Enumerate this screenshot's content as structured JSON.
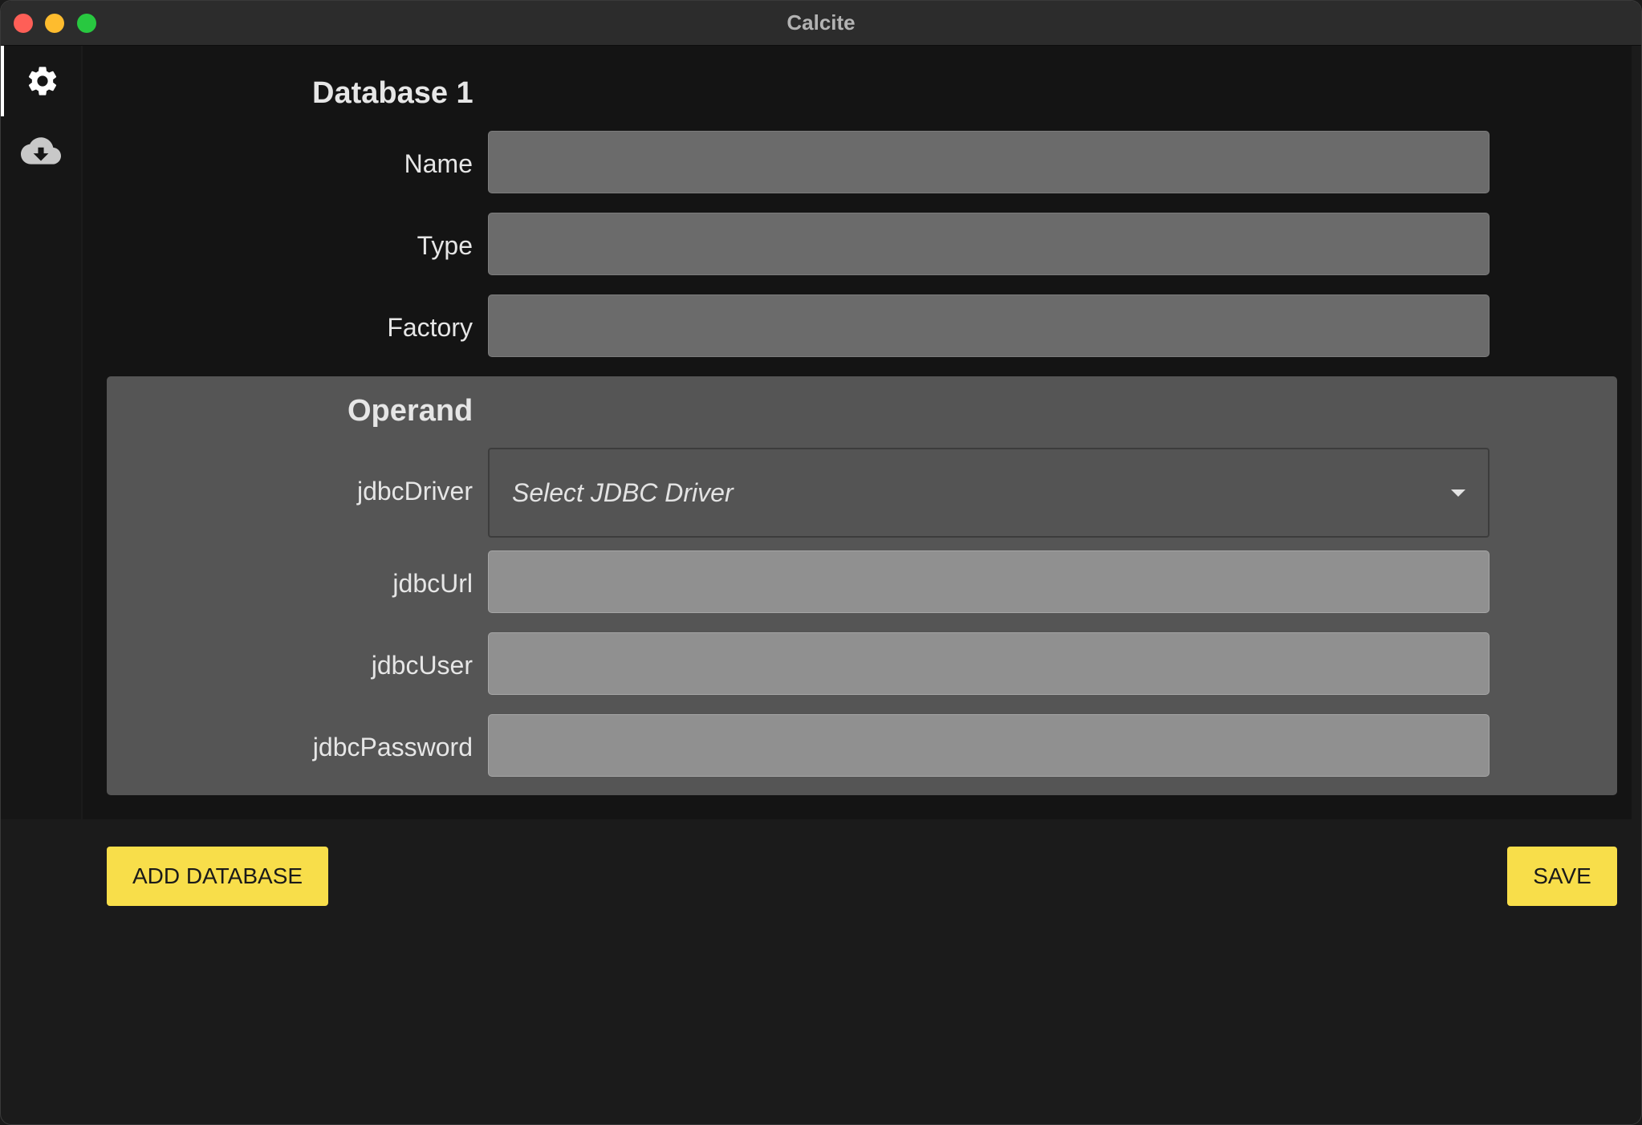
{
  "window": {
    "title": "Calcite"
  },
  "sidebar": {
    "items": [
      {
        "icon": "gear-icon",
        "active": true
      },
      {
        "icon": "cloud-download-icon",
        "active": false
      }
    ]
  },
  "database": {
    "title": "Database 1",
    "fields": [
      {
        "label": "Name",
        "value": ""
      },
      {
        "label": "Type",
        "value": ""
      },
      {
        "label": "Factory",
        "value": ""
      }
    ]
  },
  "operand": {
    "title": "Operand",
    "jdbc_driver": {
      "label": "jdbcDriver",
      "placeholder": "Select JDBC Driver"
    },
    "fields": [
      {
        "label": "jdbcUrl",
        "value": ""
      },
      {
        "label": "jdbcUser",
        "value": ""
      },
      {
        "label": "jdbcPassword",
        "value": ""
      }
    ]
  },
  "actions": {
    "add_database_label": "ADD DATABASE",
    "save_label": "SAVE"
  },
  "colors": {
    "accent": "#f8de4a",
    "background": "#1b1b1b",
    "operand_panel": "#555555"
  }
}
